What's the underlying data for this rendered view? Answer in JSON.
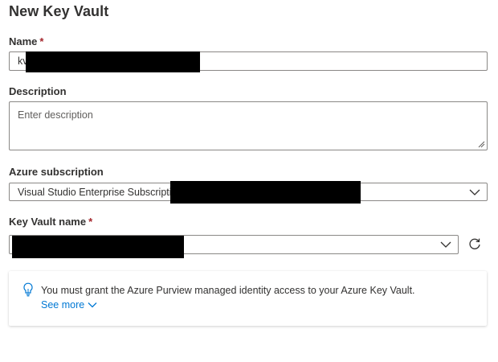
{
  "panel": {
    "title": "New Key Vault"
  },
  "name_field": {
    "label": "Name",
    "required_mark": "*",
    "value": "kv"
  },
  "description_field": {
    "label": "Description",
    "placeholder": "Enter description"
  },
  "subscription_field": {
    "label": "Azure subscription",
    "value": "Visual Studio Enterprise Subscription",
    "icon": "chevron-down-icon"
  },
  "key_vault_name_field": {
    "label": "Key Vault name",
    "required_mark": "*",
    "value": "",
    "icon": "chevron-down-icon",
    "refresh_icon": "refresh-icon"
  },
  "info": {
    "icon": "lightbulb-icon",
    "message": "You must grant the Azure Purview managed identity access to your Azure Key Vault.",
    "see_more_label": "See more",
    "see_more_icon": "chevron-down-icon"
  },
  "colors": {
    "accent": "#0078d4",
    "required": "#a4262c",
    "border": "#8a8886",
    "text": "#323130"
  }
}
